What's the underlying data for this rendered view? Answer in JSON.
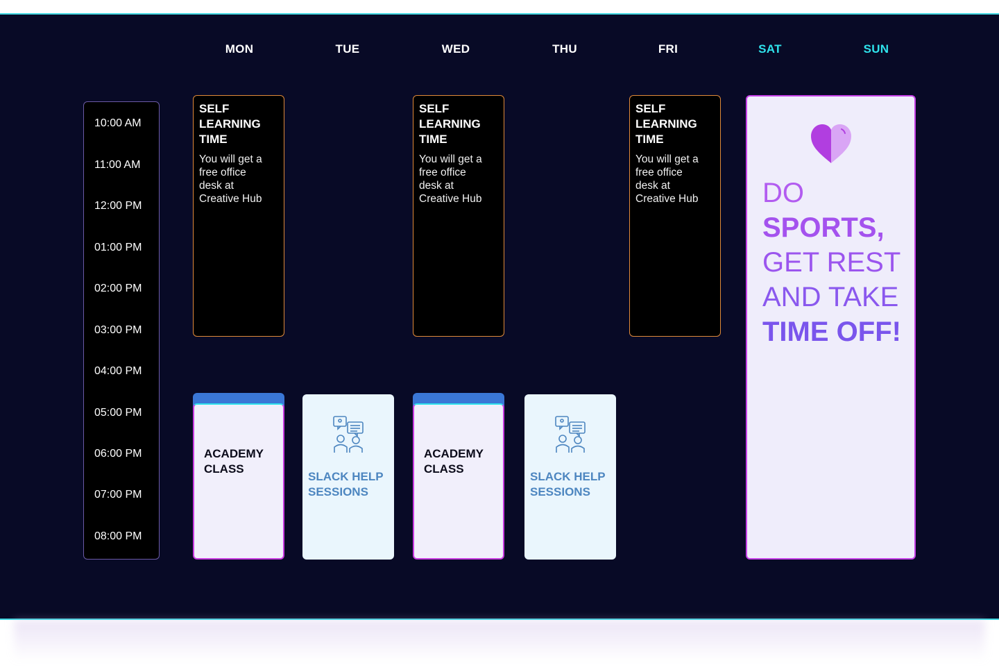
{
  "days": [
    "MON",
    "TUE",
    "WED",
    "THU",
    "FRI",
    "SAT",
    "SUN"
  ],
  "times": [
    "10:00 AM",
    "11:00 AM",
    "12:00 PM",
    "01:00 PM",
    "02:00 PM",
    "03:00 PM",
    "04:00 PM",
    "05:00 PM",
    "06:00 PM",
    "07:00 PM",
    "08:00 PM"
  ],
  "self_learning": {
    "title_lines": [
      "SELF",
      "LEARNING",
      "TIME"
    ],
    "desc_lines": [
      "You will get a",
      "free office",
      "desk at",
      "Creative Hub"
    ]
  },
  "academy": {
    "lines": [
      "ACADEMY",
      "CLASS"
    ]
  },
  "slack": {
    "lines": [
      "SLACK HELP",
      "SESSIONS"
    ],
    "icon": "help-session-icon"
  },
  "weekend": {
    "icon": "heart-icon",
    "lines": [
      "DO",
      "SPORTS,",
      "GET REST",
      "AND TAKE",
      "TIME OFF!"
    ]
  },
  "colors": {
    "background": "#080a26",
    "accent_cyan": "#2fe3ec",
    "self_border": "#e08a3a",
    "academy_tab": "#3a77d6",
    "purple": "#a356ee",
    "slack_text": "#4d86c0"
  }
}
